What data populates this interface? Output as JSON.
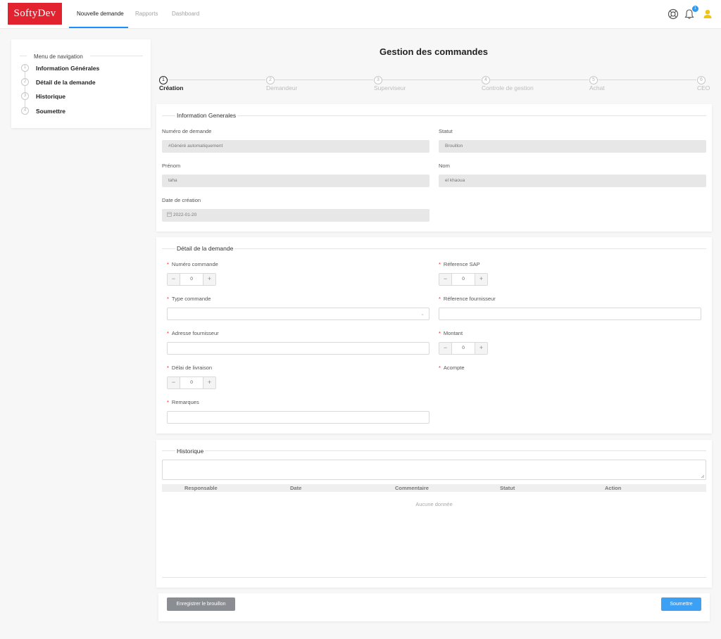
{
  "app": {
    "logo": "SoftyDev",
    "nav_tabs": [
      {
        "label": "Nouvelle demande",
        "active": true
      },
      {
        "label": "Rapports",
        "active": false
      },
      {
        "label": "Dashboard",
        "active": false
      }
    ],
    "notification_count": "1",
    "icons": [
      "support-icon",
      "bell-icon",
      "user-icon"
    ],
    "accent_color": "#1890ff",
    "brand_color": "#e2232f"
  },
  "sidebar": {
    "title": "Menu de navigation",
    "items": [
      {
        "number": "1",
        "label": "Information Générales"
      },
      {
        "number": "2",
        "label": "Détail de la demande"
      },
      {
        "number": "3",
        "label": "Historique"
      },
      {
        "number": "4",
        "label": "Soumettre"
      }
    ]
  },
  "page_title": "Gestion des commandes",
  "workflow_steps": [
    {
      "number": "1",
      "label": "Création",
      "active": true
    },
    {
      "number": "2",
      "label": "Demandeur",
      "active": false
    },
    {
      "number": "3",
      "label": "Superviseur",
      "active": false
    },
    {
      "number": "4",
      "label": "Controle de gestion",
      "active": false
    },
    {
      "number": "5",
      "label": "Achat",
      "active": false
    },
    {
      "number": "6",
      "label": "CEO",
      "active": false
    }
  ],
  "info_section": {
    "title": "Information Generales",
    "numero_label": "Numéro de demande",
    "numero_value": "#Généré automatiquement",
    "statut_label": "Statut",
    "statut_value": "Brouillon",
    "prenom_label": "Prénom",
    "prenom_value": "taha",
    "nom_label": "Nom",
    "nom_value": "el khaoua",
    "date_label": "Date de création",
    "date_value": "2022-01-20"
  },
  "detail_section": {
    "title": "Détail de la demande",
    "numero_commande_label": "Numéro commande",
    "numero_commande_value": "0",
    "reference_sap_label": "Réference SAP",
    "reference_sap_value": "0",
    "type_commande_label": "Type commande",
    "reference_fournisseur_label": "Réference fournisseur",
    "adresse_fournisseur_label": "Adresse fournisseur",
    "montant_label": "Montant",
    "montant_value": "0",
    "delai_label": "Délai de livraison",
    "delai_value": "0",
    "acompte_label": "Acompte",
    "remarques_label": "Remarques",
    "required_mark": "*",
    "minus": "−",
    "plus": "+"
  },
  "history_section": {
    "title": "Historique",
    "columns": [
      "Responsable",
      "Date",
      "Commentaire",
      "Statut",
      "Action"
    ],
    "empty_text": "Aucune donnée"
  },
  "actions": {
    "draft_label": "Enregistrer le brouillon",
    "submit_label": "Soumettre"
  }
}
